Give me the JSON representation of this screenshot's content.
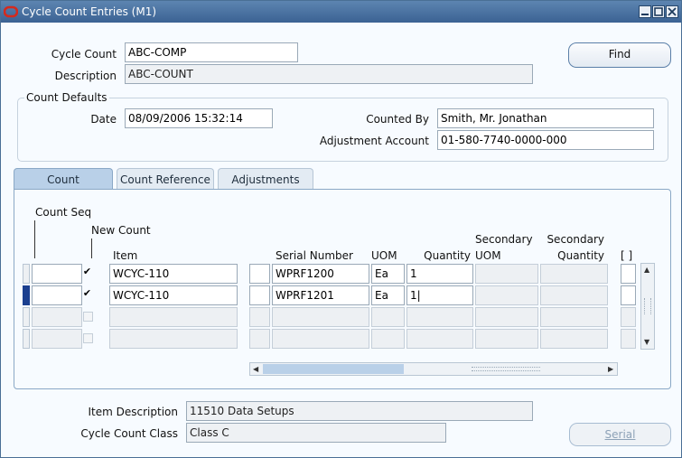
{
  "window": {
    "title": "Cycle Count Entries (M1)"
  },
  "header": {
    "cycle_count_label": "Cycle Count",
    "cycle_count_value": "ABC-COMP",
    "description_label": "Description",
    "description_value": "ABC-COUNT",
    "find_button": "Find"
  },
  "count_defaults": {
    "group_label": "Count Defaults",
    "date_label": "Date",
    "date_value": "08/09/2006 15:32:14",
    "counted_by_label": "Counted By",
    "counted_by_value": "Smith, Mr. Jonathan",
    "adj_account_label": "Adjustment Account",
    "adj_account_value": "01-580-7740-0000-000"
  },
  "tabs": [
    {
      "label": "Count",
      "active": true
    },
    {
      "label": "Count Reference",
      "active": false
    },
    {
      "label": "Adjustments",
      "active": false
    }
  ],
  "grid": {
    "headers": {
      "count_seq": "Count Seq",
      "new_count": "New Count",
      "item": "Item",
      "serial": "Serial Number",
      "uom": "UOM",
      "quantity": "Quantity",
      "sec_uom_1": "Secondary",
      "sec_uom_2": "UOM",
      "sec_qty_1": "Secondary",
      "sec_qty_2": "Quantity",
      "flex": "[ ]"
    },
    "rows": [
      {
        "count_seq": "",
        "new_count": "✔",
        "item": "WCYC-110",
        "serial": "WPRF1200",
        "uom": "Ea",
        "quantity": "1"
      },
      {
        "count_seq": "",
        "new_count": "✔",
        "item": "WCYC-110",
        "serial": "WPRF1201",
        "uom": "Ea",
        "quantity": "1|"
      },
      {
        "count_seq": "",
        "new_count": "",
        "item": "",
        "serial": "",
        "uom": "",
        "quantity": ""
      },
      {
        "count_seq": "",
        "new_count": "",
        "item": "",
        "serial": "",
        "uom": "",
        "quantity": ""
      }
    ]
  },
  "footer": {
    "item_desc_label": "Item Description",
    "item_desc_value": "11510 Data Setups",
    "class_label": "Cycle Count Class",
    "class_value": "Class C",
    "serial_button": "Serial"
  },
  "colors": {
    "titlebar": "#3b6293",
    "active_tab": "#b9d0e8",
    "current_row": "#fbe9b2",
    "oracle_red": "#d42a1e"
  }
}
